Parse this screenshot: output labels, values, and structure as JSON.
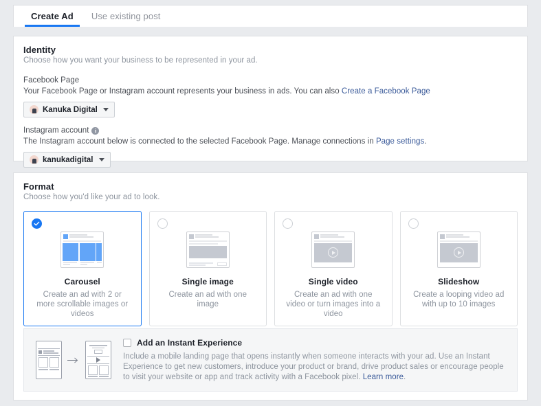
{
  "tabs": [
    {
      "label": "Create Ad",
      "active": true
    },
    {
      "label": "Use existing post",
      "active": false
    }
  ],
  "identity": {
    "title": "Identity",
    "subtitle": "Choose how you want your business to be represented in your ad.",
    "facebook_page": {
      "label": "Facebook Page",
      "description": "Your Facebook Page or Instagram account represents your business in ads. You can also ",
      "link": "Create a Facebook Page",
      "selected": "Kanuka Digital"
    },
    "instagram_account": {
      "label": "Instagram account",
      "info_glyph": "i",
      "description_before": "The Instagram account below is connected to the selected Facebook Page. Manage connections in ",
      "link": "Page settings",
      "description_after": ".",
      "selected": "kanukadigital"
    }
  },
  "format": {
    "title": "Format",
    "subtitle": "Choose how you'd like your ad to look.",
    "options": [
      {
        "name": "Carousel",
        "description": "Create an ad with 2 or more scrollable images or videos",
        "selected": true,
        "thumb": "carousel-thumbnail"
      },
      {
        "name": "Single image",
        "description": "Create an ad with one image",
        "selected": false,
        "thumb": "single-image-thumbnail"
      },
      {
        "name": "Single video",
        "description": "Create an ad with one video or turn images into a video",
        "selected": false,
        "thumb": "single-video-thumbnail"
      },
      {
        "name": "Slideshow",
        "description": "Create a looping video ad with up to 10 images",
        "selected": false,
        "thumb": "slideshow-thumbnail"
      }
    ]
  },
  "instant_experience": {
    "title": "Add an Instant Experience",
    "checked": false,
    "description": "Include a mobile landing page that opens instantly when someone interacts with your ad. Use an Instant Experience to get new customers, introduce your product or brand, drive product sales or encourage people to visit your website or app and track activity with a Facebook pixel. ",
    "link": "Learn more",
    "description_after": "."
  },
  "colors": {
    "accent": "#1877f2",
    "link": "#385898",
    "page_bg": "#e9ebee",
    "card_bg": "#ffffff",
    "border": "#dddfe2",
    "text": "#1d2129",
    "muted": "#8d949e",
    "carousel_blue": "#62a5f8"
  }
}
